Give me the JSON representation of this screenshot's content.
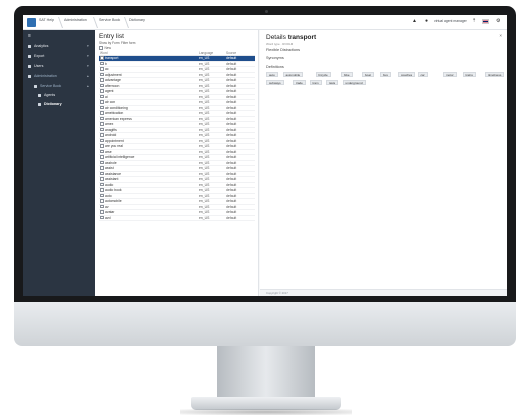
{
  "topbar": {
    "breadcrumbs": [
      "SAT Help",
      "Administration",
      "Service Book",
      "Dictionary"
    ],
    "user_name": "virtual agent manager",
    "icons": [
      "bell-icon",
      "user-icon",
      "pin-icon",
      "settings-icon"
    ]
  },
  "sidebar": {
    "items": [
      {
        "label": "Analytics",
        "icon": "chart-icon"
      },
      {
        "label": "Export",
        "icon": "export-icon"
      },
      {
        "label": "Users",
        "icon": "users-icon"
      },
      {
        "label": "Administration",
        "icon": "admin-icon"
      },
      {
        "label": "Service Book",
        "icon": "book-icon"
      },
      {
        "label": "Agents",
        "icon": "agent-icon"
      },
      {
        "label": "Dictionary",
        "icon": "dictionary-icon"
      }
    ]
  },
  "list": {
    "title": "Entry list",
    "filter_label": "Show by Form",
    "filter_value": "Filter form",
    "new_label": "New",
    "columns": [
      "Word",
      "Language",
      "Source"
    ],
    "rows": [
      {
        "word": "transport",
        "lang": "en_US",
        "source": "default"
      },
      {
        "word": "b",
        "lang": "en_US",
        "source": "default"
      },
      {
        "word": "ac",
        "lang": "en_US",
        "source": "default"
      },
      {
        "word": "adjustment",
        "lang": "en_US",
        "source": "default"
      },
      {
        "word": "advantage",
        "lang": "en_US",
        "source": "default"
      },
      {
        "word": "afternoon",
        "lang": "en_US",
        "source": "default"
      },
      {
        "word": "agent",
        "lang": "en_US",
        "source": "default"
      },
      {
        "word": "ai",
        "lang": "en_US",
        "source": "default"
      },
      {
        "word": "air con",
        "lang": "en_US",
        "source": "default"
      },
      {
        "word": "air conditioning",
        "lang": "en_US",
        "source": "default"
      },
      {
        "word": "amebication",
        "lang": "en_US",
        "source": "default"
      },
      {
        "word": "american express",
        "lang": "en_US",
        "source": "default"
      },
      {
        "word": "amex",
        "lang": "en_US",
        "source": "default"
      },
      {
        "word": "anagifts",
        "lang": "en_US",
        "source": "default"
      },
      {
        "word": "android",
        "lang": "en_US",
        "source": "default"
      },
      {
        "word": "appointment",
        "lang": "en_US",
        "source": "default"
      },
      {
        "word": "are you real",
        "lang": "en_US",
        "source": "default"
      },
      {
        "word": "arse",
        "lang": "en_US",
        "source": "default"
      },
      {
        "word": "artificial intelligence",
        "lang": "en_US",
        "source": "default"
      },
      {
        "word": "asshole",
        "lang": "en_US",
        "source": "default"
      },
      {
        "word": "assist",
        "lang": "en_US",
        "source": "default"
      },
      {
        "word": "assistance",
        "lang": "en_US",
        "source": "default"
      },
      {
        "word": "assistant",
        "lang": "en_US",
        "source": "default"
      },
      {
        "word": "audio",
        "lang": "en_US",
        "source": "default"
      },
      {
        "word": "audio book",
        "lang": "en_US",
        "source": "default"
      },
      {
        "word": "auto",
        "lang": "en_US",
        "source": "default"
      },
      {
        "word": "automobile",
        "lang": "en_US",
        "source": "default"
      },
      {
        "word": "av",
        "lang": "en_US",
        "source": "default"
      },
      {
        "word": "avatar",
        "lang": "en_US",
        "source": "default"
      },
      {
        "word": "avd",
        "lang": "en_US",
        "source": "default"
      }
    ]
  },
  "details": {
    "title_prefix": "Details",
    "title_word": "transport",
    "meta": "Word type  ·  ROOLM",
    "subtitle": "Flexible Distractions",
    "synonyms_label": "Synonyms",
    "definitions_label": "Definitions",
    "chips": [
      "auto",
      "automobile",
      "bicycle",
      "bike",
      "boat",
      "bus",
      "coaches",
      "car",
      "motor",
      "trains",
      "timeliness",
      "subways",
      "trade",
      "tram",
      "taxis",
      "underground"
    ]
  },
  "footer": {
    "text": "Copyright © 2017"
  }
}
